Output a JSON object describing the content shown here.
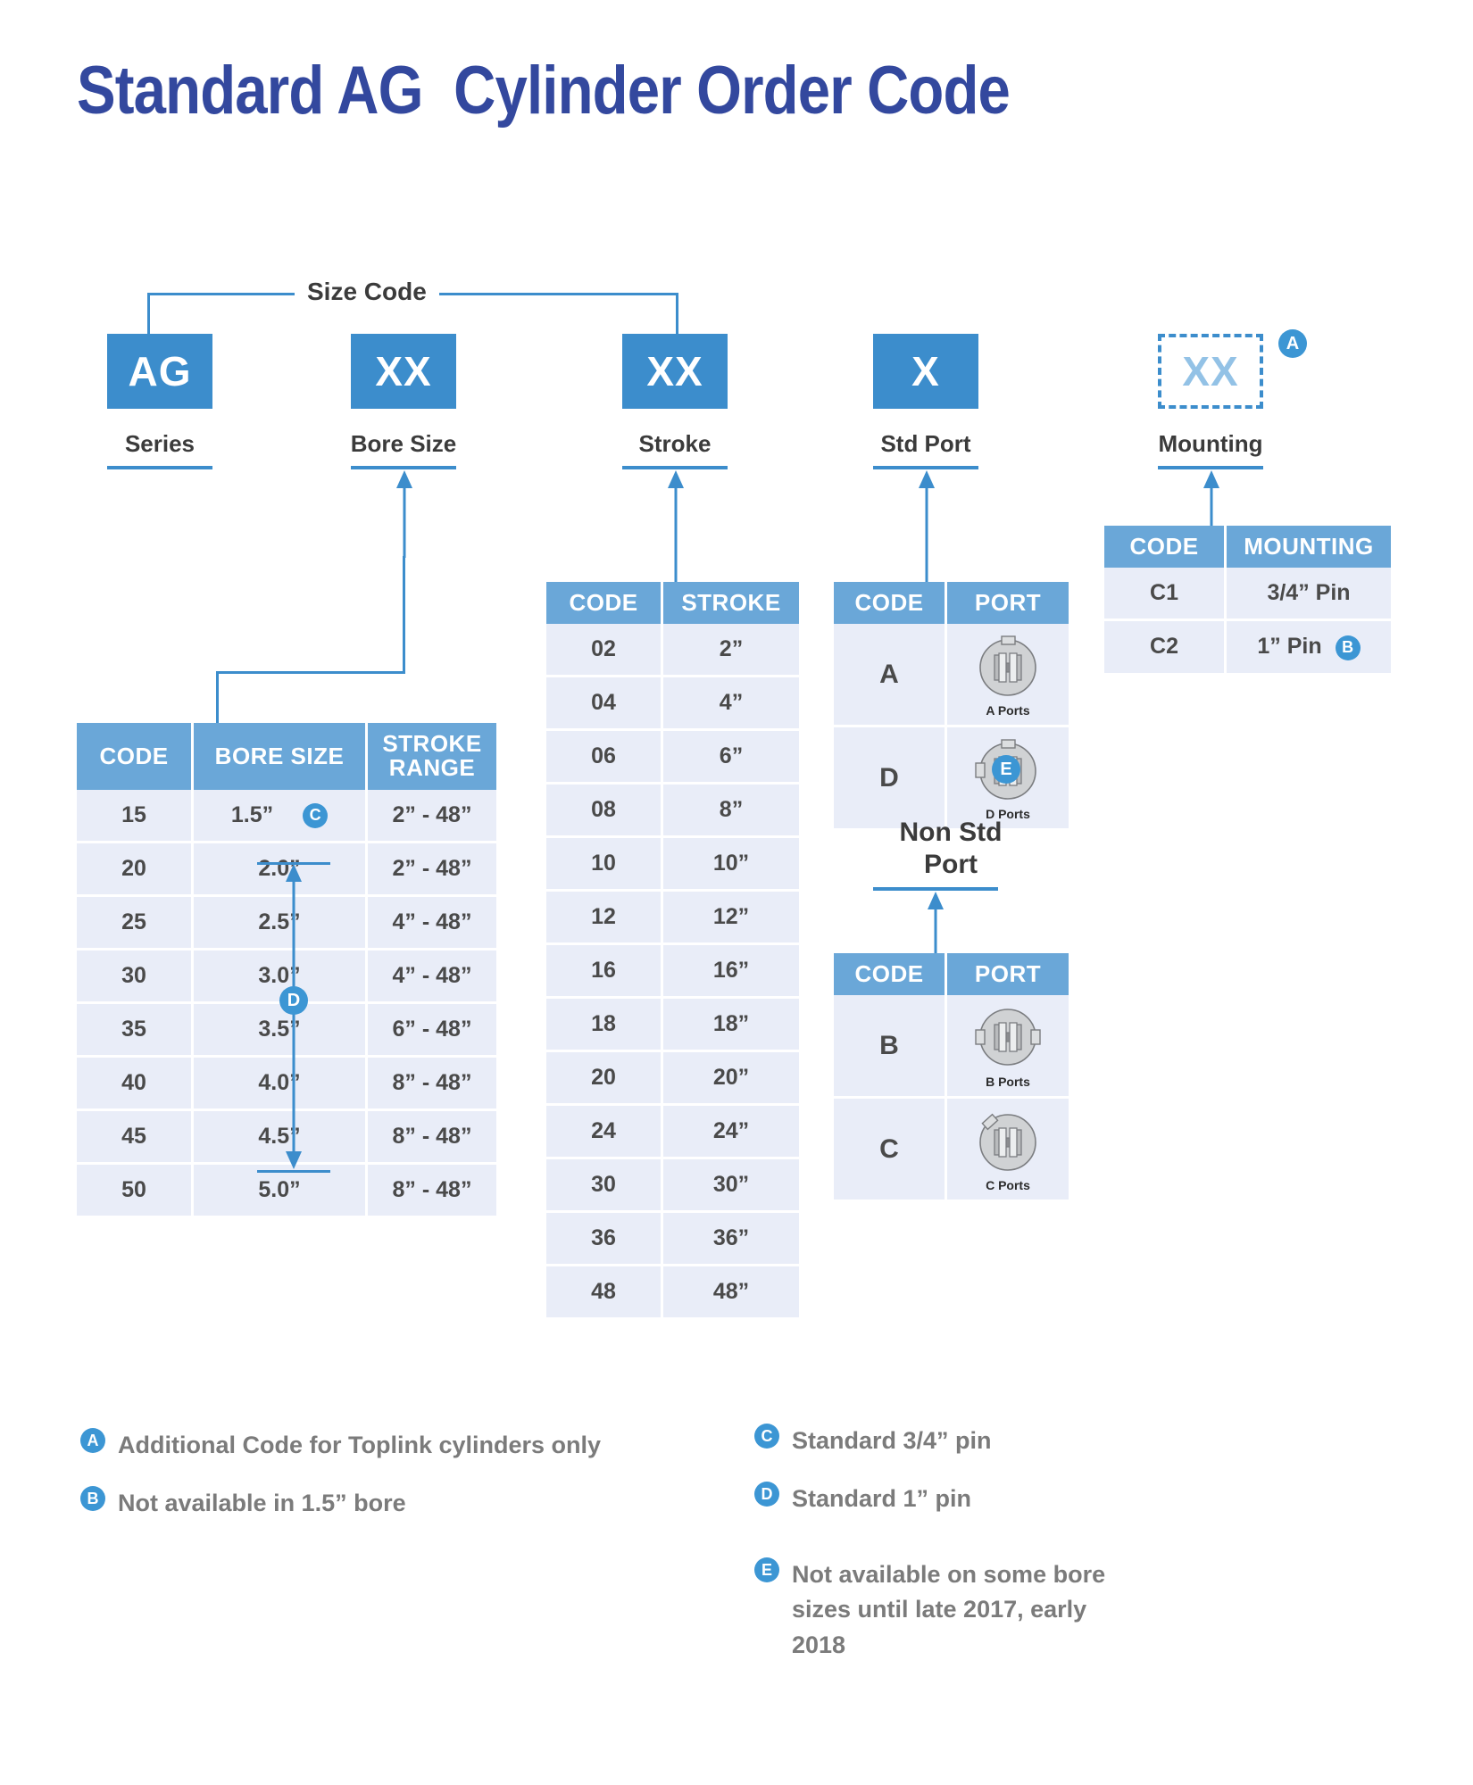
{
  "title": "Standard AG  Cylinder Order Code",
  "size_code_label": "Size Code",
  "code_boxes": [
    {
      "code": "AG",
      "label": "Series"
    },
    {
      "code": "XX",
      "label": "Bore Size"
    },
    {
      "code": "XX",
      "label": "Stroke"
    },
    {
      "code": "X",
      "label": "Std Port"
    },
    {
      "code": "XX",
      "label": "Mounting",
      "note": "A",
      "dashed": true
    }
  ],
  "bore_table": {
    "headers": [
      "CODE",
      "BORE SIZE",
      "STROKE RANGE"
    ],
    "rows": [
      {
        "code": "15",
        "bore": "1.5”",
        "range": "2” - 48”",
        "note": "C"
      },
      {
        "code": "20",
        "bore": "2.0”",
        "range": "2” - 48”"
      },
      {
        "code": "25",
        "bore": "2.5”",
        "range": "4” - 48”"
      },
      {
        "code": "30",
        "bore": "3.0”",
        "range": "4” - 48”"
      },
      {
        "code": "35",
        "bore": "3.5”",
        "range": "6” - 48”"
      },
      {
        "code": "40",
        "bore": "4.0”",
        "range": "8” - 48”"
      },
      {
        "code": "45",
        "bore": "4.5”",
        "range": "8” - 48”"
      },
      {
        "code": "50",
        "bore": "5.0”",
        "range": "8” - 48”"
      }
    ],
    "span_note": "D"
  },
  "stroke_table": {
    "headers": [
      "CODE",
      "STROKE"
    ],
    "rows": [
      {
        "code": "02",
        "stroke": "2”"
      },
      {
        "code": "04",
        "stroke": "4”"
      },
      {
        "code": "06",
        "stroke": "6”"
      },
      {
        "code": "08",
        "stroke": "8”"
      },
      {
        "code": "10",
        "stroke": "10”"
      },
      {
        "code": "12",
        "stroke": "12”"
      },
      {
        "code": "16",
        "stroke": "16”"
      },
      {
        "code": "18",
        "stroke": "18”"
      },
      {
        "code": "20",
        "stroke": "20”"
      },
      {
        "code": "24",
        "stroke": "24”"
      },
      {
        "code": "30",
        "stroke": "30”"
      },
      {
        "code": "36",
        "stroke": "36”"
      },
      {
        "code": "48",
        "stroke": "48”"
      }
    ]
  },
  "std_port_table": {
    "headers": [
      "CODE",
      "PORT"
    ],
    "rows": [
      {
        "code": "A",
        "caption": "A Ports",
        "icon": "a-ports-icon"
      },
      {
        "code": "D",
        "caption": "D Ports",
        "icon": "d-ports-icon",
        "note": "E"
      }
    ]
  },
  "non_std_port": {
    "title": "Non Std Port",
    "headers": [
      "CODE",
      "PORT"
    ],
    "rows": [
      {
        "code": "B",
        "caption": "B Ports",
        "icon": "b-ports-icon"
      },
      {
        "code": "C",
        "caption": "C Ports",
        "icon": "c-ports-icon"
      }
    ]
  },
  "mounting_table": {
    "headers": [
      "CODE",
      "MOUNTING"
    ],
    "rows": [
      {
        "code": "C1",
        "mounting": "3/4” Pin"
      },
      {
        "code": "C2",
        "mounting": "1” Pin",
        "note": "B"
      }
    ]
  },
  "legend_left": [
    {
      "key": "A",
      "text": "Additional Code for Toplink cylinders only"
    },
    {
      "key": "B",
      "text": "Not available in 1.5” bore"
    }
  ],
  "legend_right": [
    {
      "key": "C",
      "text": "Standard 3/4” pin"
    },
    {
      "key": "D",
      "text": "Standard 1” pin"
    },
    {
      "key": "E",
      "text": "Not available on some bore sizes until late 2017, early 2018"
    }
  ],
  "colors": {
    "title_blue": "#33489e",
    "box_blue": "#3c8dcc",
    "header_blue": "#6aa7d8",
    "row_bg": "#e9edf8",
    "bubble_blue": "#3c96d4",
    "text_gray": "#4a4a4a"
  }
}
